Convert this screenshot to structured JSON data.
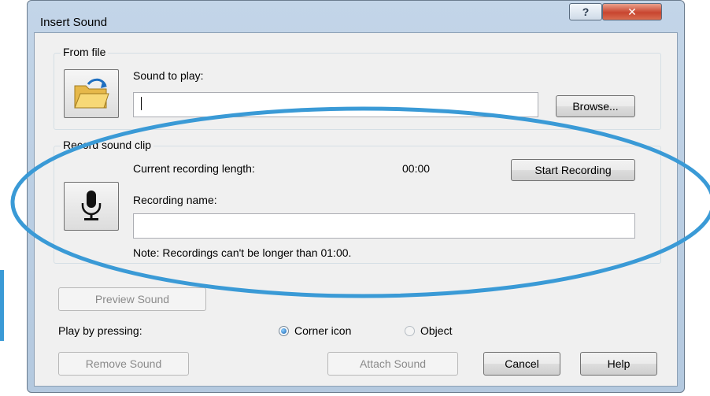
{
  "window": {
    "title": "Insert Sound",
    "help_glyph": "?",
    "close_glyph": "✕"
  },
  "from_file": {
    "group_label": "From file",
    "icon": "folder-open-icon",
    "sound_to_play_label": "Sound to play:",
    "sound_to_play_value": "",
    "browse_label": "Browse..."
  },
  "record": {
    "group_label": "Record sound clip",
    "icon": "microphone-icon",
    "length_label": "Current recording length:",
    "length_value": "00:00",
    "start_label": "Start Recording",
    "name_label": "Recording name:",
    "name_value": "",
    "note": "Note: Recordings can't be longer than 01:00."
  },
  "preview_label": "Preview Sound",
  "play_by": {
    "label": "Play by pressing:",
    "options": [
      {
        "label": "Corner icon",
        "selected": true
      },
      {
        "label": "Object",
        "selected": false
      }
    ]
  },
  "footer": {
    "remove_label": "Remove Sound",
    "attach_label": "Attach Sound",
    "cancel_label": "Cancel",
    "help_label": "Help"
  },
  "colors": {
    "annotation_ellipse": "#3a9ad6",
    "title_bar": "#c3d5e8",
    "close_button": "#c8452f"
  }
}
